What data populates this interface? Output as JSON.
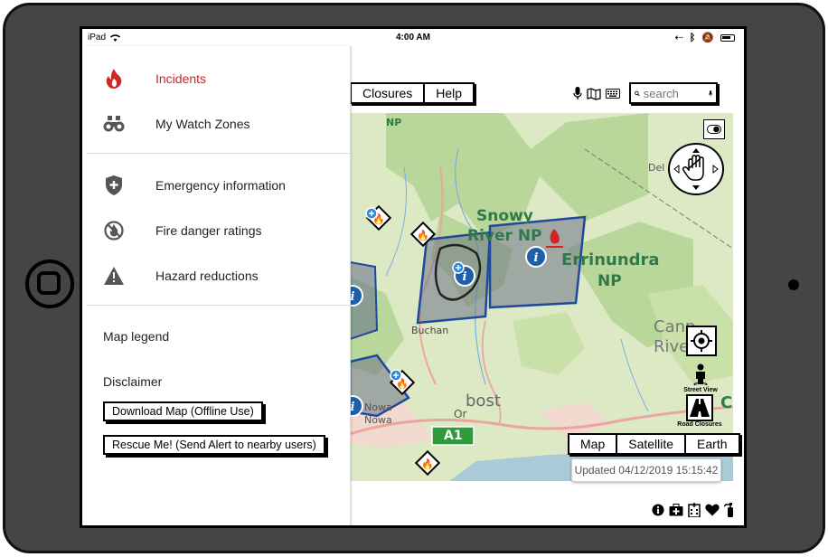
{
  "statusbar": {
    "device": "iPad",
    "time": "4:00 AM"
  },
  "toolbar": {
    "closures_label": "Closures",
    "help_label": "Help"
  },
  "search": {
    "placeholder": "search"
  },
  "map": {
    "labels": {
      "np_top": "NP",
      "snowy_line1": "Snowy",
      "snowy_line2": "River NP",
      "errinundra_line1": "Errinundra",
      "errinundra_line2": "NP",
      "buchan": "Buchan",
      "orbost_or": "Or",
      "orbost_bost": "bost",
      "nowa_line1": "Nowa",
      "nowa_line2": "Nowa",
      "dele": "Del",
      "cann_line1": "Cann",
      "cann_line2": "Rive",
      "road": "A1",
      "c_label": "C"
    },
    "street_view_label": "Street View",
    "road_closures_label": "Road Closures",
    "map_types": [
      "Map",
      "Satellite",
      "Earth"
    ],
    "updated": "Updated 04/12/2019 15:15:42"
  },
  "drawer": {
    "items": [
      {
        "label": "Incidents",
        "icon": "fire-icon"
      },
      {
        "label": "My Watch Zones",
        "icon": "binoculars-icon"
      },
      {
        "label": "Emergency information",
        "icon": "shield-plus-icon"
      },
      {
        "label": "Fire danger ratings",
        "icon": "no-fire-icon"
      },
      {
        "label": "Hazard reductions",
        "icon": "warning-icon"
      }
    ],
    "map_legend": "Map legend",
    "disclaimer": "Disclaimer",
    "download_btn": "Download Map (Offline Use)",
    "rescue_btn": "Rescue Me! (Send Alert to nearby users)"
  },
  "colors": {
    "accent_red": "#d32424",
    "polygon_blue": "#1f4a9c",
    "park_green": "#b9d79a"
  }
}
